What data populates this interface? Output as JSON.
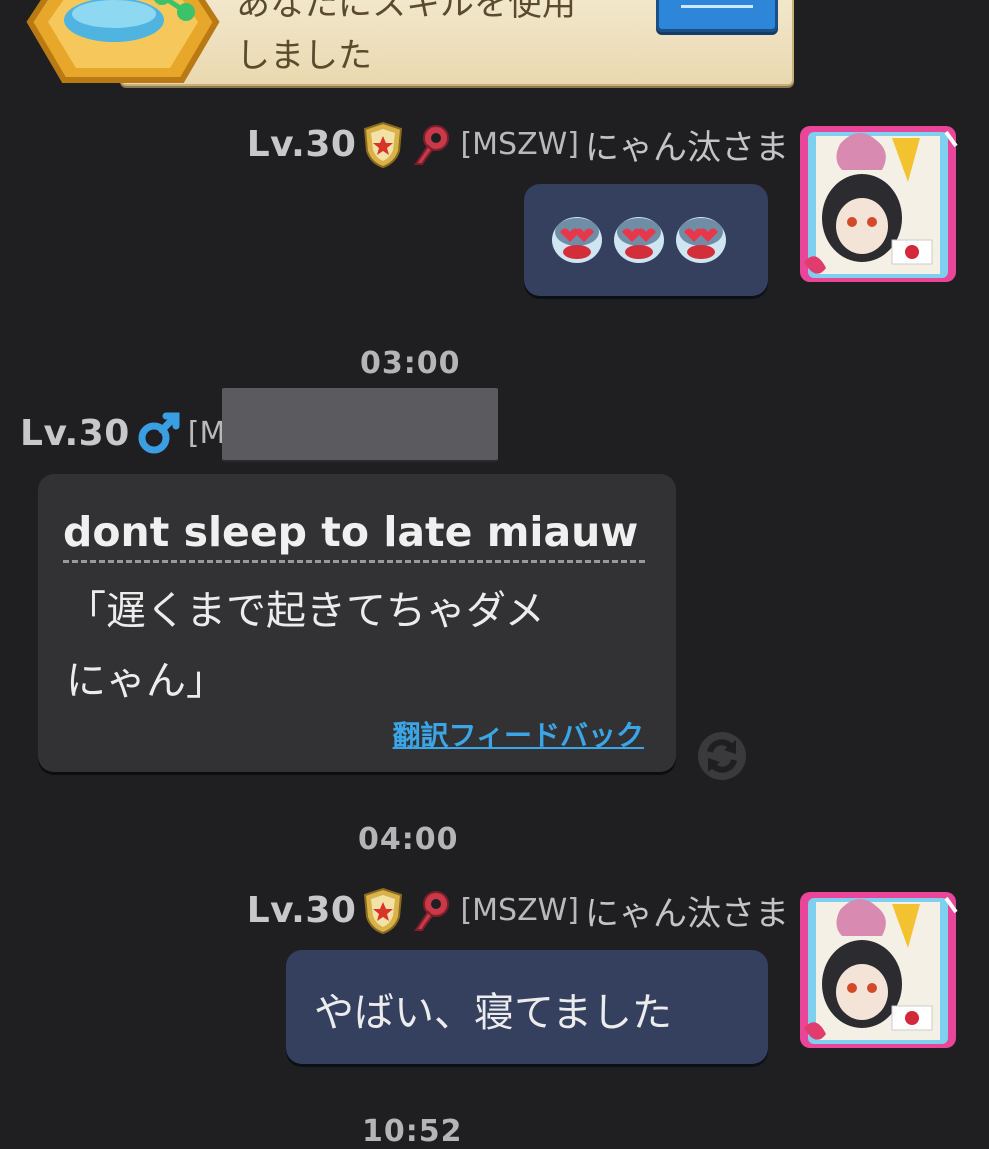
{
  "system_notice": {
    "line1": "あなたにスキルを使用",
    "line2": "しました"
  },
  "messages": [
    {
      "id": "msg1",
      "level": "Lv.30",
      "clan_tag": "[MSZW]",
      "sender": "にゃん汰さま",
      "content_type": "emotes",
      "emote_count": 3,
      "side": "right"
    },
    {
      "id": "time1",
      "timestamp": "03:00"
    },
    {
      "id": "msg2",
      "level": "Lv.30",
      "clan_tag_partial": "[M",
      "translated_text": "dont sleep to late miauw",
      "original_line1": "「遅くまで起きてちゃダメ",
      "original_line2": "にゃん」",
      "feedback_label": "翻訳フィードバック",
      "side": "left"
    },
    {
      "id": "time2",
      "timestamp": "04:00"
    },
    {
      "id": "msg3",
      "level": "Lv.30",
      "clan_tag": "[MSZW]",
      "sender": "にゃん汰さま",
      "text": "やばい、寝てました",
      "side": "right"
    },
    {
      "id": "time3",
      "timestamp": "10:52"
    }
  ],
  "colors": {
    "background": "#1f1f21",
    "my_bubble": "#35405f",
    "other_bubble": "#323234",
    "link": "#3aa6e8"
  }
}
